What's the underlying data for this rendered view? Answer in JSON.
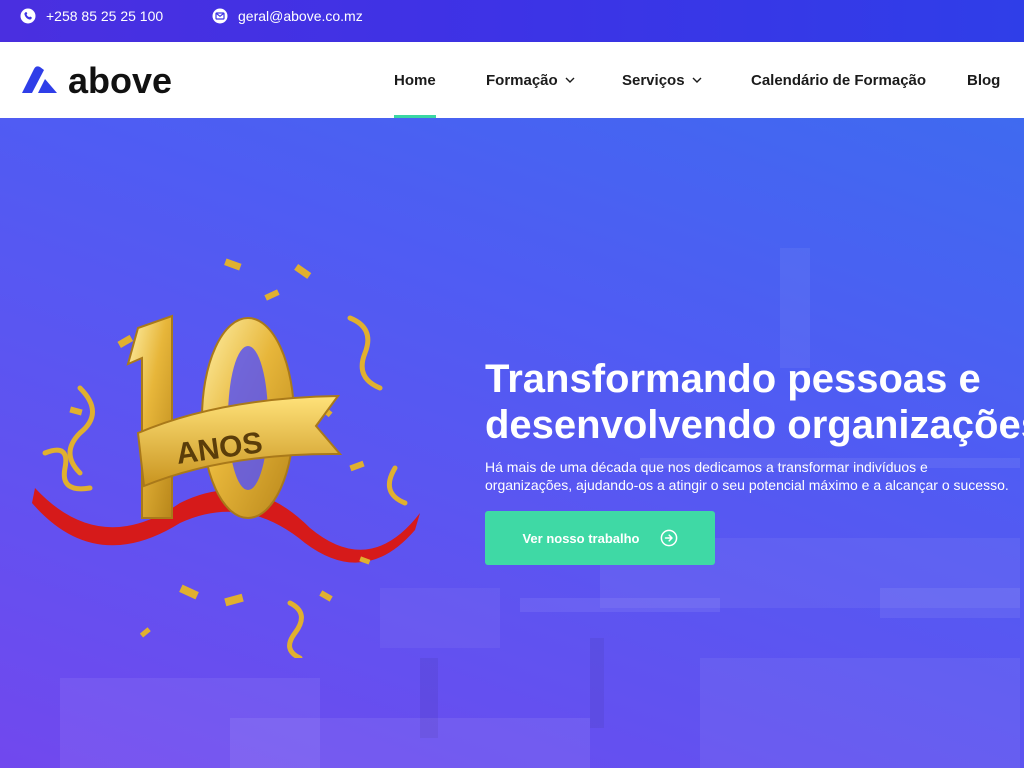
{
  "topbar": {
    "phone": "+258 85 25 25 100",
    "email": "geral@above.co.mz",
    "phone_icon": "phone-icon",
    "email_icon": "mail-icon"
  },
  "brand": {
    "name": "above",
    "logo_icon": "above-logo-icon",
    "color": "#2f3ee8"
  },
  "nav": {
    "items": [
      {
        "label": "Home",
        "active": true,
        "has_dropdown": false
      },
      {
        "label": "Formação",
        "active": false,
        "has_dropdown": true
      },
      {
        "label": "Serviços",
        "active": false,
        "has_dropdown": true
      },
      {
        "label": "Calendário de Formação",
        "active": false,
        "has_dropdown": false
      },
      {
        "label": "Blog",
        "active": false,
        "has_dropdown": false
      }
    ],
    "active_color": "#3ad6a4"
  },
  "hero": {
    "badge": {
      "number": "10",
      "banner_text": "ANOS"
    },
    "title_line1": "Transformando pessoas e",
    "title_line2": "desenvolvendo organizações",
    "subtitle_line1": "Há mais de uma década que nos dedicamos a transformar indivíduos e",
    "subtitle_line2": "organizações, ajudando-os a atingir o seu potencial máximo e a alcançar o sucesso.",
    "cta_label": "Ver nosso trabalho",
    "cta_icon": "arrow-right-circle-icon",
    "cta_color": "#3fd9a5"
  }
}
